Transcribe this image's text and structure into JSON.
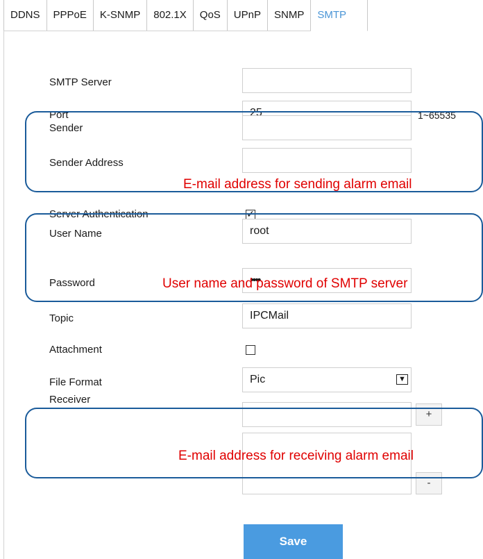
{
  "tabs": [
    {
      "label": "DDNS"
    },
    {
      "label": "PPPoE"
    },
    {
      "label": "K-SNMP"
    },
    {
      "label": "802.1X"
    },
    {
      "label": "QoS"
    },
    {
      "label": "UPnP"
    },
    {
      "label": "SNMP"
    },
    {
      "label": "SMTP",
      "active": true
    }
  ],
  "form": {
    "smtp_server": {
      "label": "SMTP Server",
      "value": ""
    },
    "port": {
      "label": "Port",
      "value": "25",
      "range": "1~65535"
    },
    "sender": {
      "label": "Sender",
      "value": ""
    },
    "sender_address": {
      "label": "Sender Address",
      "value": ""
    },
    "server_authentication": {
      "label": "Server Authentication",
      "checked": true,
      "check_glyph": "✓"
    },
    "user_name": {
      "label": "User Name",
      "value": "root"
    },
    "password": {
      "label": "Password",
      "value": "••••"
    },
    "topic": {
      "label": "Topic",
      "value": "IPCMail"
    },
    "attachment": {
      "label": "Attachment",
      "checked": false
    },
    "file_format": {
      "label": "File Format",
      "value": "Pic",
      "arrow": "▼"
    },
    "receiver": {
      "label": "Receiver",
      "value": "",
      "add": "+",
      "remove": "-"
    }
  },
  "save_label": "Save",
  "annotations": {
    "sender": "E-mail address for sending alarm email",
    "auth": "User name and password of SMTP server",
    "receiver": "E-mail address for receiving alarm email"
  },
  "colors": {
    "accent": "#4a9be0",
    "callout_border": "#1a5b9a",
    "callout_text": "#e00000"
  }
}
